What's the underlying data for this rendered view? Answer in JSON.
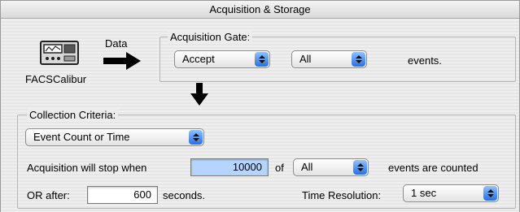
{
  "window": {
    "title": "Acquisition & Storage"
  },
  "device": {
    "label": "FACSCalibur",
    "icon": "cytometer-icon"
  },
  "flow": {
    "data_label": "Data"
  },
  "acquisition_gate": {
    "label": "Acquisition Gate:",
    "mode_value": "Accept",
    "gate_value": "All",
    "suffix": "events."
  },
  "collection_criteria": {
    "label": "Collection Criteria:",
    "criteria_value": "Event Count or Time",
    "stop_prefix": "Acquisition will stop when",
    "event_count": "10000",
    "of_label": "of",
    "count_gate_value": "All",
    "stop_suffix": "events are counted",
    "or_after_label": "OR after:",
    "seconds_value": "600",
    "seconds_label": "seconds.",
    "time_resolution_label": "Time Resolution:",
    "time_resolution_value": "1 sec"
  },
  "colors": {
    "popup_arrow": "#2a6fe0",
    "selected_field": "#b5d5ff"
  }
}
